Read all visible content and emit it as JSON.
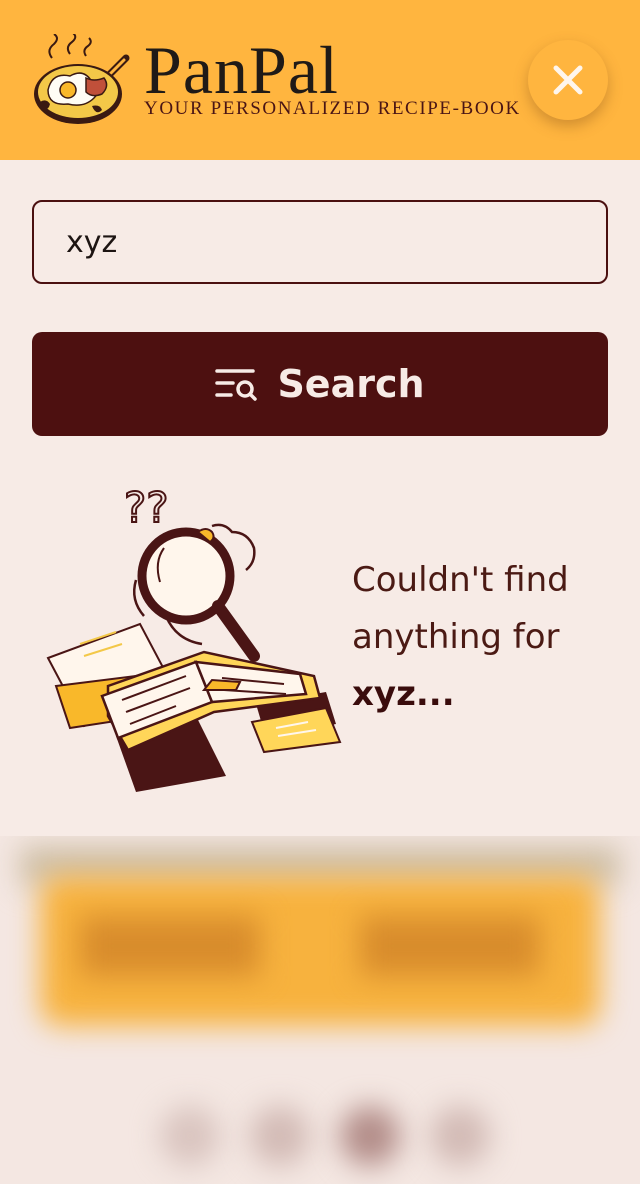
{
  "header": {
    "title": "PanPal",
    "subtitle": "YOUR PERSONALIZED RECIPE-BOOK",
    "close_icon": "close-icon"
  },
  "search": {
    "value": "xyz",
    "button_label": "Search",
    "button_icon": "filter-search-icon"
  },
  "empty_state": {
    "message": "Couldn't find anything for",
    "term": "xyz..."
  },
  "colors": {
    "accent": "#ffb53f",
    "primary": "#4d1010",
    "background": "#f7ebe6"
  }
}
